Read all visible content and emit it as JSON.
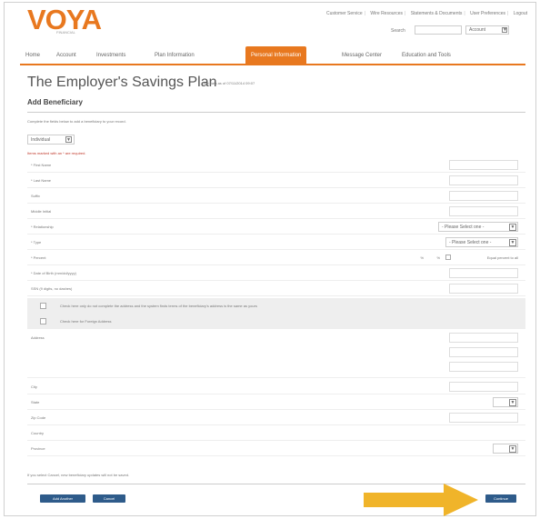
{
  "brand": {
    "logo_text": "VOYA",
    "tagline": "FINANCIAL"
  },
  "utility_links": [
    "Customer Service",
    "Wire Resources",
    "Statements & Documents",
    "User Preferences",
    "Logout"
  ],
  "search": {
    "label": "Search",
    "placeholder": "",
    "scope_value": "Account"
  },
  "nav": {
    "items": [
      {
        "label": "Home"
      },
      {
        "label": "Account"
      },
      {
        "label": "Investments"
      },
      {
        "label": "Plan Information"
      },
      {
        "label": "Personal Information"
      },
      {
        "label": "Message Center"
      },
      {
        "label": "Education and Tools"
      }
    ],
    "active_index": 4
  },
  "page": {
    "title": "The Employer's Savings Plan",
    "title_sub": "Last data as of 07/11/2014 09:07",
    "section_title": "Add Beneficiary",
    "intro": "Complete the fields below to add a beneficiary to your record.",
    "beneficiary_type": "Individual",
    "required_note": "Items marked with an * are required.",
    "footer_note": "If you select Cancel, new beneficiary updates will not be saved."
  },
  "form": {
    "first_name_label": "* First Name",
    "last_name_label": "* Last Name",
    "suffix_label": "Suffix",
    "middle_initial_label": "Middle Initial",
    "relationship_label": "* Relationship",
    "relationship_value": "- Please Select one -",
    "type_label": "* Type",
    "type_value": "- Please Select one -",
    "percent_label": "* Percent",
    "percent_prefix": "%",
    "percent_suffix": "%",
    "equal_label": "Equal percent to all",
    "dob_label": "* Date of Birth (mm/dd/yyyy)",
    "ssn_label": "SSN (9 digits, no dashes)",
    "same_address_label": "Check here only do not complete the address and the system finds terms of the beneficiary's address is the same as yours",
    "foreign_address_label": "Check here for Foreign Address",
    "address_label": "Address",
    "city_label": "City",
    "state_label": "State",
    "zip_label": "Zip Code",
    "country_label": "Country",
    "province_label": "Province"
  },
  "buttons": {
    "add_another": "Add Another",
    "cancel": "Cancel",
    "continue": "Continue"
  },
  "colors": {
    "accent": "#e8781f",
    "button": "#2e5b8a",
    "arrow": "#f0b42a"
  }
}
